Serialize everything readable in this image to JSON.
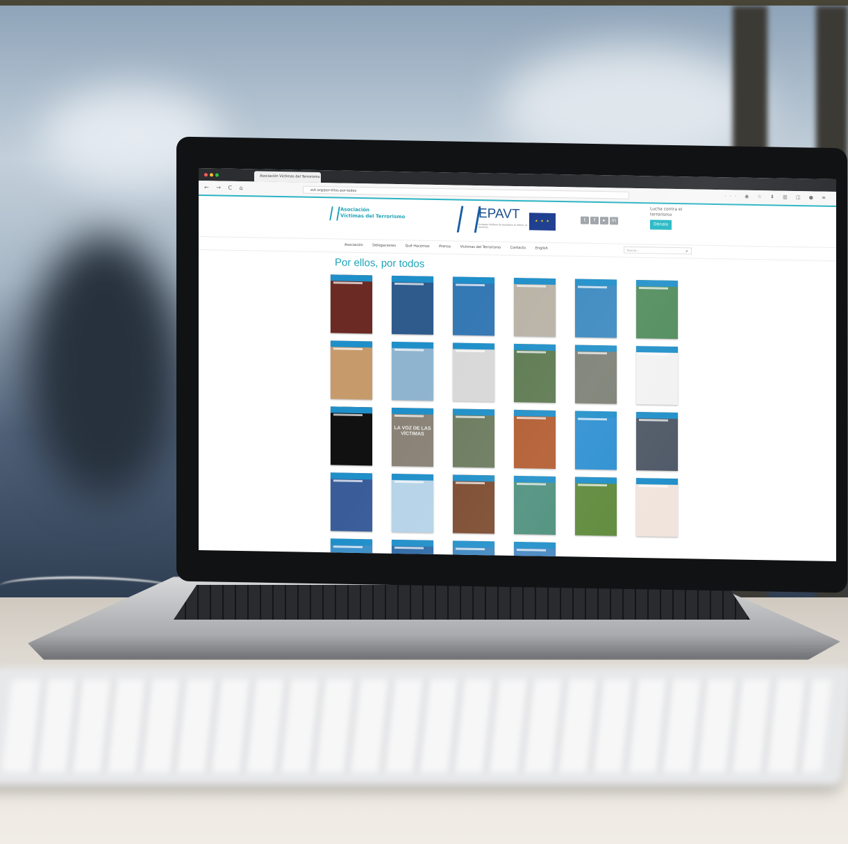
{
  "browser": {
    "tab_title": "Asociación Víctimas del Terrorismo",
    "url": "avt.org/por-ellos-por-todos",
    "nav_buttons": "← → C ⌂",
    "toolbar_icons": "··· ◉ ☆   ⬇ ▥ ◫ ● ≡"
  },
  "site": {
    "logo_line1": "Asociación",
    "logo_line2": "Víctimas del Terrorismo",
    "epavt_title": "EPAVT",
    "epavt_subtitle": "European Platform for Assistance to Victims of Terrorism",
    "eu_flag_text": "★ ★ ★",
    "socials": [
      "t",
      "f",
      "▸",
      "in"
    ],
    "cta_text": "Lucha contra el terrorismo",
    "cta_button": "Dónalo",
    "menu": [
      "Asociación",
      "Delegaciones",
      "Qué Hacemos",
      "Prensa",
      "Víctimas del Terrorismo",
      "Contacto",
      "English"
    ],
    "search_placeholder": "Buscar...",
    "search_icon": "search-icon",
    "page_title": "Por ellos, por todos"
  },
  "covers": [
    {
      "color": "#6b2a24",
      "text": ""
    },
    {
      "color": "#2f5b8c",
      "text": ""
    },
    {
      "color": "#3478b4",
      "text": ""
    },
    {
      "color": "#b9b3a6",
      "text": ""
    },
    {
      "color": "#3b89c0",
      "text": ""
    },
    {
      "color": "#4f8b5b",
      "text": ""
    },
    {
      "color": "#c79a6c",
      "text": ""
    },
    {
      "color": "#8fb4cf",
      "text": ""
    },
    {
      "color": "#d8d8d8",
      "text": ""
    },
    {
      "color": "#5d7a51",
      "text": ""
    },
    {
      "color": "#7c7f74",
      "text": ""
    },
    {
      "color": "#f2f2f2",
      "text": ""
    },
    {
      "color": "#111111",
      "text": ""
    },
    {
      "color": "#8a8276",
      "text": "LA VOZ DE LAS VÍCTIMAS"
    },
    {
      "color": "#6c7b5e",
      "text": ""
    },
    {
      "color": "#b25b2f",
      "text": ""
    },
    {
      "color": "#2d8fd1",
      "text": ""
    },
    {
      "color": "#4e5866",
      "text": ""
    },
    {
      "color": "#3a5d9a",
      "text": ""
    },
    {
      "color": "#b6d3e8",
      "text": ""
    },
    {
      "color": "#7b4a2e",
      "text": ""
    },
    {
      "color": "#4d8f7c",
      "text": ""
    },
    {
      "color": "#5f8a3c",
      "text": ""
    },
    {
      "color": "#f1e4dc",
      "text": ""
    },
    {
      "color": "#3d8fc8",
      "text": ""
    },
    {
      "color": "#2f6aa6",
      "text": ""
    },
    {
      "color": "#3c86c0",
      "text": ""
    },
    {
      "color": "#4687c2",
      "text": ""
    }
  ]
}
